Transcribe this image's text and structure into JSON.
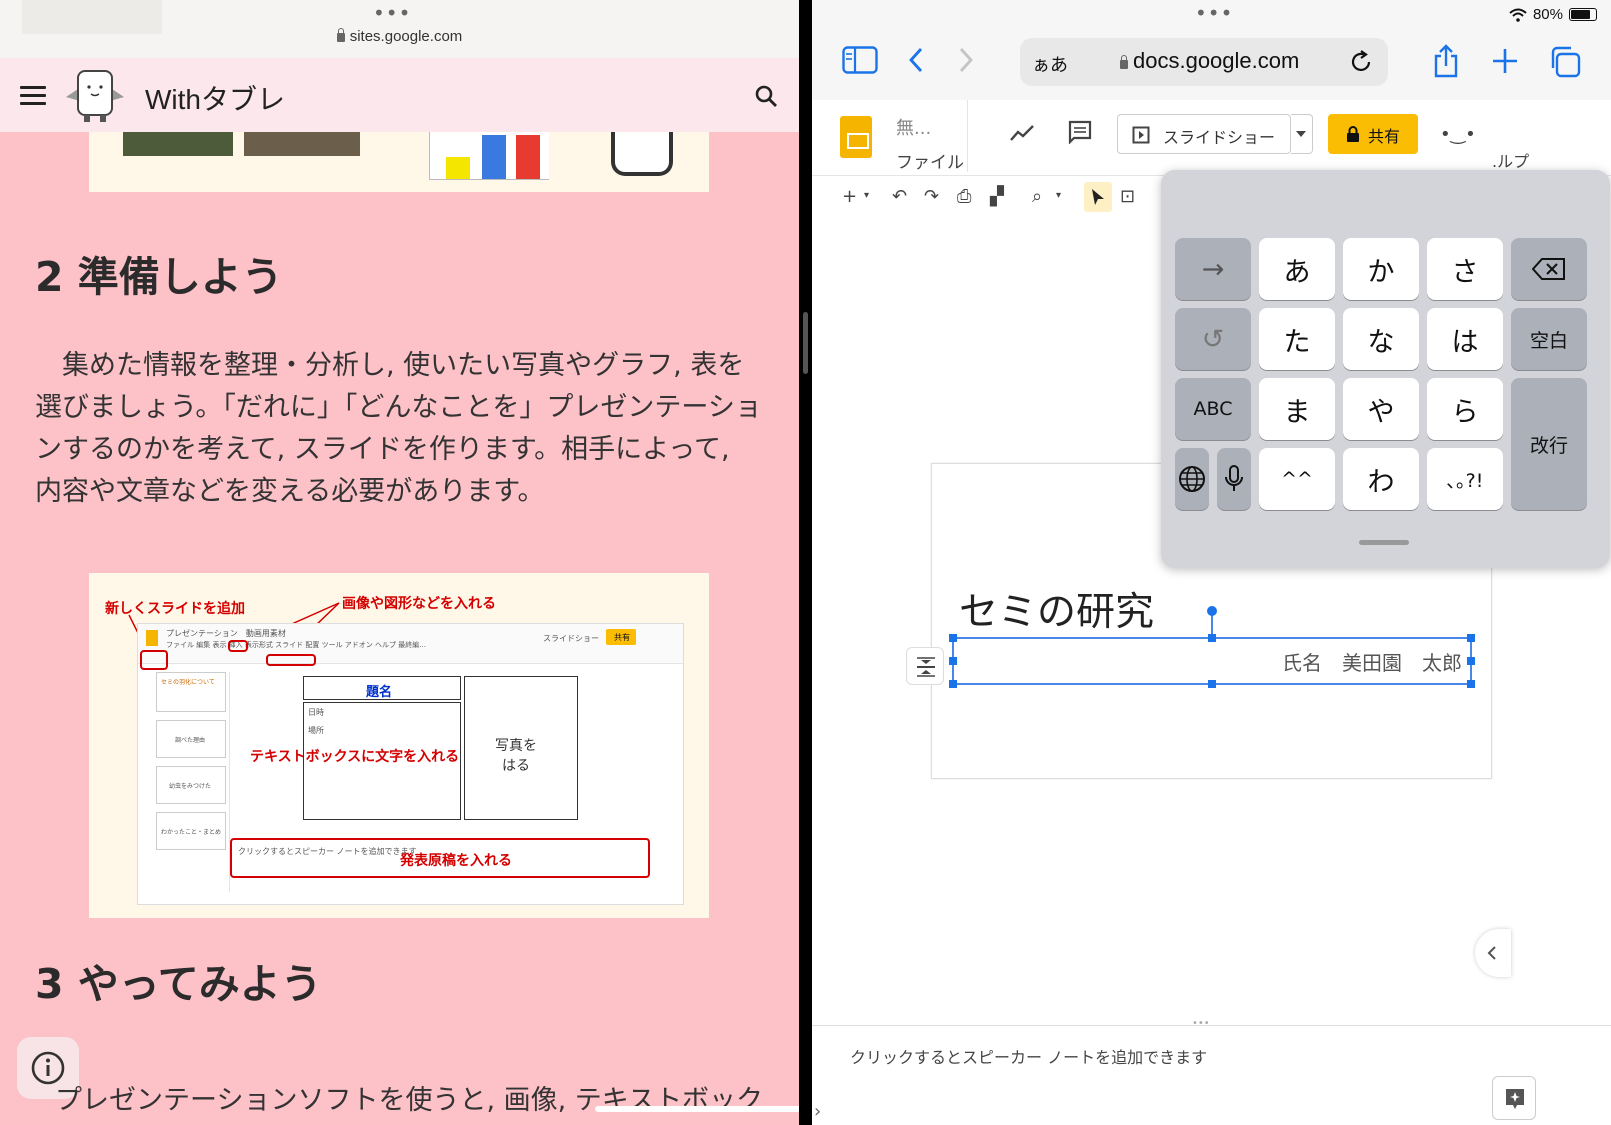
{
  "left_browser": {
    "url": "sites.google.com",
    "site_title": "Withタブレ",
    "section2_heading": "2 準備しよう",
    "section2_paragraph": "　集めた情報を整理・分析し, 使いたい写真やグラフ, 表を選びましょう。「だれに」「どんなことを」プレゼンテーションするのかを考えて, スライドを作ります。相手によって, 内容や文章などを変える必要があります。",
    "figure": {
      "annotation_add_slide": "新しくスライドを追加",
      "annotation_insert_image": "画像や図形などを入れる",
      "annotation_textbox": "テキストボックスに文字を入れる",
      "annotation_notes": "発表原稿を入れる",
      "app_title": "プレゼンテーション　動画用素材",
      "menu_items": "ファイル 編集 表示 挿入 表示形式 スライド 配置 ツール アドオン ヘルプ 最終編...",
      "slideshow": "スライドショー",
      "share": "共有",
      "slide_box_title": "題名",
      "slide_box_date": "日時",
      "slide_box_place": "場所",
      "slide_photo": "写真を\nはる",
      "notes_placeholder": "クリックするとスピーカー ノートを追加できます",
      "thumb_1": "セミの羽化について",
      "thumb_2": "調べた理由",
      "thumb_3": "幼虫をみつけた",
      "thumb_4": "わかったこと・まとめ"
    },
    "section3_heading": "3 やってみよう",
    "section3_para_start": "プレゼンテーションソフトを使うと, 画像, テキストボック"
  },
  "right_browser": {
    "battery": "80%",
    "address_prefix": "ぁあ",
    "url": "docs.google.com",
    "doc_title": "無...",
    "file_menu": "ファイル",
    "slideshow_label": "スライドショー",
    "share_label": "共有",
    "help_fragment": ".ルプ",
    "slide_title": "セミの研究",
    "slide_name": "氏名　美田園　太郎",
    "notes_placeholder": "クリックするとスピーカー ノートを追加できます"
  },
  "keyboard": {
    "rows": [
      [
        "→",
        "あ",
        "か",
        "さ",
        "⌫"
      ],
      [
        "↺",
        "た",
        "な",
        "は",
        "空白"
      ],
      [
        "ABC",
        "ま",
        "や",
        "ら",
        "改行"
      ],
      [
        "🌐",
        "🎤",
        "^^",
        "わ",
        "､｡?!"
      ]
    ]
  },
  "colors": {
    "page_pink": "#fdc1c8",
    "google_yellow": "#fbbc04",
    "selection_blue": "#4a86e8",
    "annotation_red": "#d40000"
  }
}
